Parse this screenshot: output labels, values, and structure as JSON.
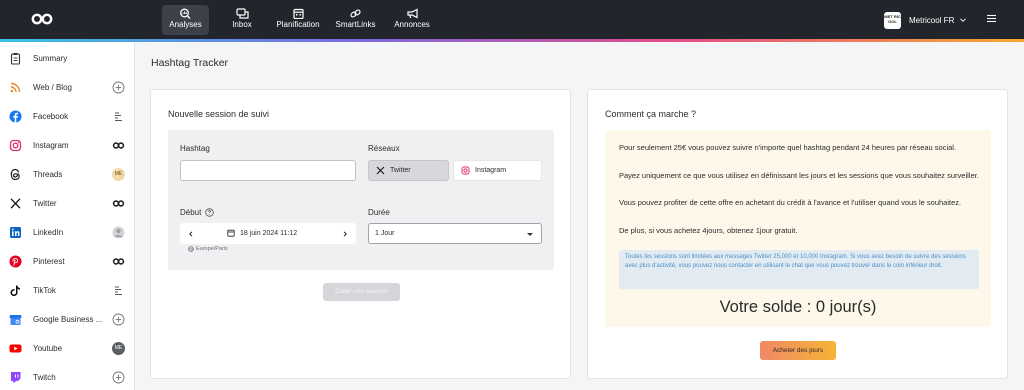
{
  "nav": {
    "items": [
      {
        "label": "Analyses",
        "icon": "analytics-search-icon"
      },
      {
        "label": "Inbox",
        "icon": "inbox-icon"
      },
      {
        "label": "Planification",
        "icon": "calendar-icon"
      },
      {
        "label": "SmartLinks",
        "icon": "link-icon"
      },
      {
        "label": "Annonces",
        "icon": "megaphone-icon"
      }
    ],
    "active": "Analyses",
    "account": {
      "name": "Metricool FR",
      "logo_text": "MET RIC OOL"
    }
  },
  "sidebar": {
    "items": [
      {
        "label": "Summary",
        "icon": "clipboard-icon",
        "action": "none"
      },
      {
        "label": "Web / Blog",
        "icon": "rss-icon",
        "action": "add"
      },
      {
        "label": "Facebook",
        "icon": "facebook-icon",
        "action": "menu"
      },
      {
        "label": "Instagram",
        "icon": "instagram-icon",
        "action": "linked"
      },
      {
        "label": "Threads",
        "icon": "threads-icon",
        "action": "avatar",
        "action_text": "ME"
      },
      {
        "label": "Twitter",
        "icon": "x-icon",
        "action": "linked"
      },
      {
        "label": "LinkedIn",
        "icon": "linkedin-icon",
        "action": "avatar-grey"
      },
      {
        "label": "Pinterest",
        "icon": "pinterest-icon",
        "action": "linked"
      },
      {
        "label": "TikTok",
        "icon": "tiktok-icon",
        "action": "menu"
      },
      {
        "label": "Google Business ...",
        "icon": "google-business-icon",
        "action": "add"
      },
      {
        "label": "Youtube",
        "icon": "youtube-icon",
        "action": "avatar-dark",
        "action_text": "ME"
      },
      {
        "label": "Twitch",
        "icon": "twitch-icon",
        "action": "add"
      }
    ]
  },
  "page": {
    "title": "Hashtag Tracker"
  },
  "session": {
    "title": "Nouvelle session de suivi",
    "hashtag_label": "Hashtag",
    "hashtag_value": "",
    "networks_label": "Réseaux",
    "networks": [
      {
        "label": "Twitter",
        "icon": "x-icon",
        "selected": true
      },
      {
        "label": "Instagram",
        "icon": "instagram-icon",
        "selected": false
      }
    ],
    "start_label": "Début",
    "start_value": "18 juin 2024 11:12",
    "timezone": "Europe/Paris",
    "duration_label": "Durée",
    "duration_value": "1 Jour",
    "create_button": "Créer une session"
  },
  "howto": {
    "title": "Comment ça marche ?",
    "paragraphs": [
      "Pour seulement 25€ vous pouvez suivre n'importe quel hashtag pendant 24 heures par réseau social.",
      "Payez uniquement ce que vous utilisez en définissant les jours et les sessions que vous souhaitez surveiller.",
      "Vous pouvez profiter de cette offre en achetant du crédit à l'avance et l'utiliser quand vous le souhaitez.",
      "De plus, si vous achetez 4jours, obtenez 1jour gratuit."
    ],
    "notice": "Toutes les sessions sont limitées aux messages Twitter 25,000 et 10,000 Instagram. Si vous avez besoin de suivre des sessions avec plus d'activité, vous pouvez nous contacter en utilisant le chat que vous pouvez trouver dans le coin inférieur droit.",
    "balance": "Votre solde : 0 jour(s)",
    "buy_button": "Acheter des jours"
  },
  "colors": {
    "topbar": "#22252b",
    "accent_gradient": [
      "#36c3e4",
      "#7b6be0",
      "#e24c8c",
      "#f7a72f"
    ],
    "info_bg": "#fef8ea",
    "notice_text": "#4a8fc9",
    "buy_gradient": [
      "#f08866",
      "#f5b436"
    ]
  }
}
